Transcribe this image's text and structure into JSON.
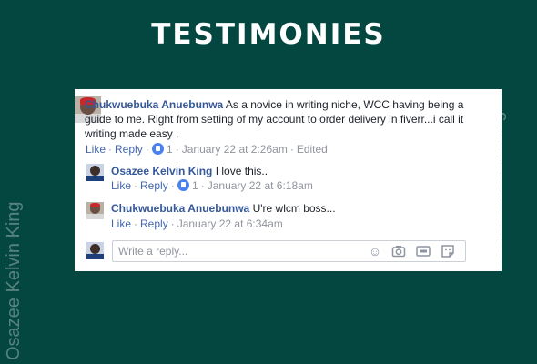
{
  "headline": "TESTIMONIES",
  "watermark": "Osazee Kelvin King",
  "comments": [
    {
      "author": "Chukwuebuka Anuebunwa",
      "text": "As a novice in writing niche, WCC having being a guide to me. Right from setting of my account to order delivery in fiverr...i call it writing made easy .",
      "like": "Like",
      "reply": "Reply",
      "reactions": "1",
      "time": "January 22 at 2:26am",
      "edited": "Edited"
    },
    {
      "author": "Osazee Kelvin King",
      "text": "I love this..",
      "like": "Like",
      "reply": "Reply",
      "reactions": "1",
      "time": "January 22 at 6:18am"
    },
    {
      "author": "Chukwuebuka Anuebunwa",
      "text": "U're wlcm boss...",
      "like": "Like",
      "reply": "Reply",
      "time": "January 22 at 6:34am"
    }
  ],
  "reply_box": {
    "placeholder": "Write a reply...",
    "icons": [
      "emoji-icon",
      "camera-icon",
      "gif-icon",
      "sticker-icon"
    ]
  },
  "colors": {
    "background": "#044640",
    "author": "#365899",
    "link": "#4267b2",
    "meta": "#90949c"
  }
}
